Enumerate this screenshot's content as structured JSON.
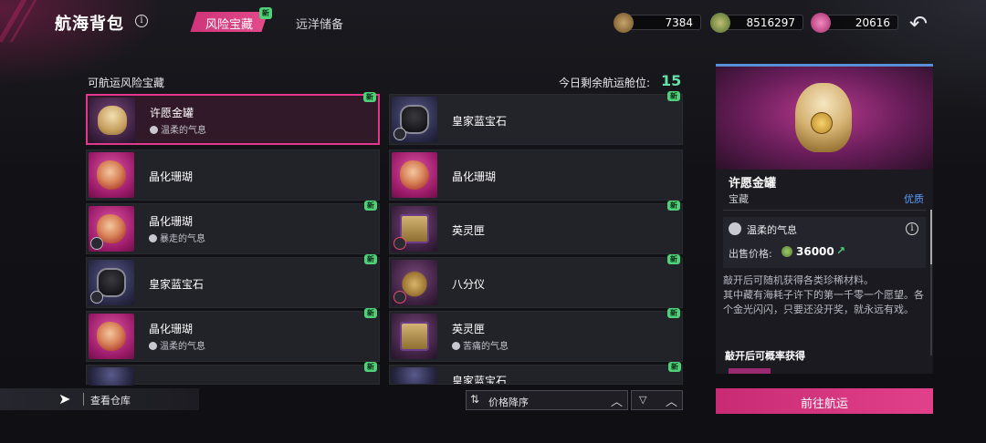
{
  "header": {
    "title": "航海背包",
    "tabs": [
      {
        "label": "风险宝藏",
        "active": true,
        "badge": "新"
      },
      {
        "label": "远洋储备",
        "active": false
      }
    ],
    "resources": [
      {
        "icon": "ore-icon",
        "value": "7384"
      },
      {
        "icon": "gold-coins-icon",
        "value": "8516297"
      },
      {
        "icon": "pink-crystal-icon",
        "value": "20616"
      }
    ]
  },
  "list": {
    "heading": "可航运风险宝藏",
    "remaining_label": "今日剩余航运舱位:",
    "remaining_value": "15",
    "items": [
      {
        "name": "许愿金罐",
        "sub": "温柔的气息",
        "new": "新",
        "thumb": "hamster"
      },
      {
        "name": "皇家蓝宝石",
        "sub": "",
        "new": "新",
        "thumb": "gem"
      },
      {
        "name": "晶化珊瑚",
        "sub": "",
        "new": "",
        "thumb": "coral"
      },
      {
        "name": "晶化珊瑚",
        "sub": "",
        "new": "",
        "thumb": "coral"
      },
      {
        "name": "晶化珊瑚",
        "sub": "暴走的气息",
        "new": "新",
        "thumb": "coral"
      },
      {
        "name": "英灵匣",
        "sub": "",
        "new": "新",
        "thumb": "chest"
      },
      {
        "name": "皇家蓝宝石",
        "sub": "",
        "new": "新",
        "thumb": "gem"
      },
      {
        "name": "八分仪",
        "sub": "",
        "new": "新",
        "thumb": "sextant"
      },
      {
        "name": "晶化珊瑚",
        "sub": "温柔的气息",
        "new": "新",
        "thumb": "coral"
      },
      {
        "name": "英灵匣",
        "sub": "苦痛的气息",
        "new": "新",
        "thumb": "chest"
      },
      {
        "name": "",
        "sub": "",
        "new": "新",
        "thumb": "gem"
      },
      {
        "name": "皇家蓝宝石",
        "sub": "",
        "new": "新",
        "thumb": "gem"
      }
    ]
  },
  "bottom": {
    "warehouse_label": "查看仓库",
    "sort_label": "价格降序"
  },
  "detail": {
    "name": "许愿金罐",
    "type": "宝藏",
    "quality": "优质",
    "mood": "温柔的气息",
    "price_label": "出售价格:",
    "price_value": "36000",
    "description_lines": [
      "敲开后可随机获得各类珍稀材料。",
      "其中藏有海耗子许下的第一千零一个愿望。各个金光闪闪，只要还没开奖，就永远有戏。"
    ],
    "drops_label": "敲开后可概率获得",
    "action_label": "前往航运"
  },
  "colors": {
    "accent": "#e2378a",
    "new_badge": "#4fd17a",
    "quality": "#5aa0ff",
    "remaining": "#66e0a8"
  }
}
